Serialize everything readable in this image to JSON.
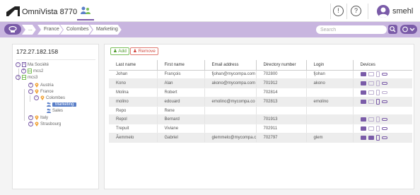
{
  "header": {
    "app_name": "OmniVista",
    "app_version": "8770",
    "username": "smehl",
    "notification_icon": "bell-alert-icon",
    "help_icon": "question-icon"
  },
  "breadcrumb": {
    "items": [
      "...",
      "France",
      "Colombes",
      "Marketing"
    ]
  },
  "search": {
    "placeholder": "Search"
  },
  "tree": {
    "root_label": "172.27.182.158",
    "items": [
      "Ma Société",
      "mcs2",
      "mcs3",
      "Austria",
      "France",
      "Colombes",
      "Marketing",
      "Sales",
      "Italy",
      "Strasbourg"
    ]
  },
  "toolbar": {
    "add_label": "Add",
    "remove_label": "Remove"
  },
  "table": {
    "columns": [
      "Last name",
      "First name",
      "Email address",
      "Directory number",
      "Login",
      "Devices"
    ],
    "rows": [
      [
        "Johan",
        "François",
        "fjohan@mycompa.com",
        "702800",
        "fjohan"
      ],
      [
        "Kono",
        "Alan",
        "akono@mycompa.com",
        "701912",
        "akono"
      ],
      [
        "Molina",
        "Robert",
        "",
        "702814",
        ""
      ],
      [
        "molino",
        "edouard",
        "emolino@mycompa.co",
        "702813",
        "emolino"
      ],
      [
        "Repo",
        "Rene",
        "",
        "",
        ""
      ],
      [
        "Repol",
        "Bernard",
        "",
        "701913",
        ""
      ],
      [
        "Trepuit",
        "Viviane",
        "",
        "702911",
        ""
      ],
      [
        "Ãemmelo",
        "Gabriel",
        "glemmelo@mycompa.c",
        "702797",
        "glem"
      ]
    ]
  },
  "colors": {
    "accent": "#7a5ba8",
    "accent_light": "#c8b5df",
    "selected": "#5a7fc8",
    "add": "#4f9a2c",
    "remove": "#d24a40"
  }
}
